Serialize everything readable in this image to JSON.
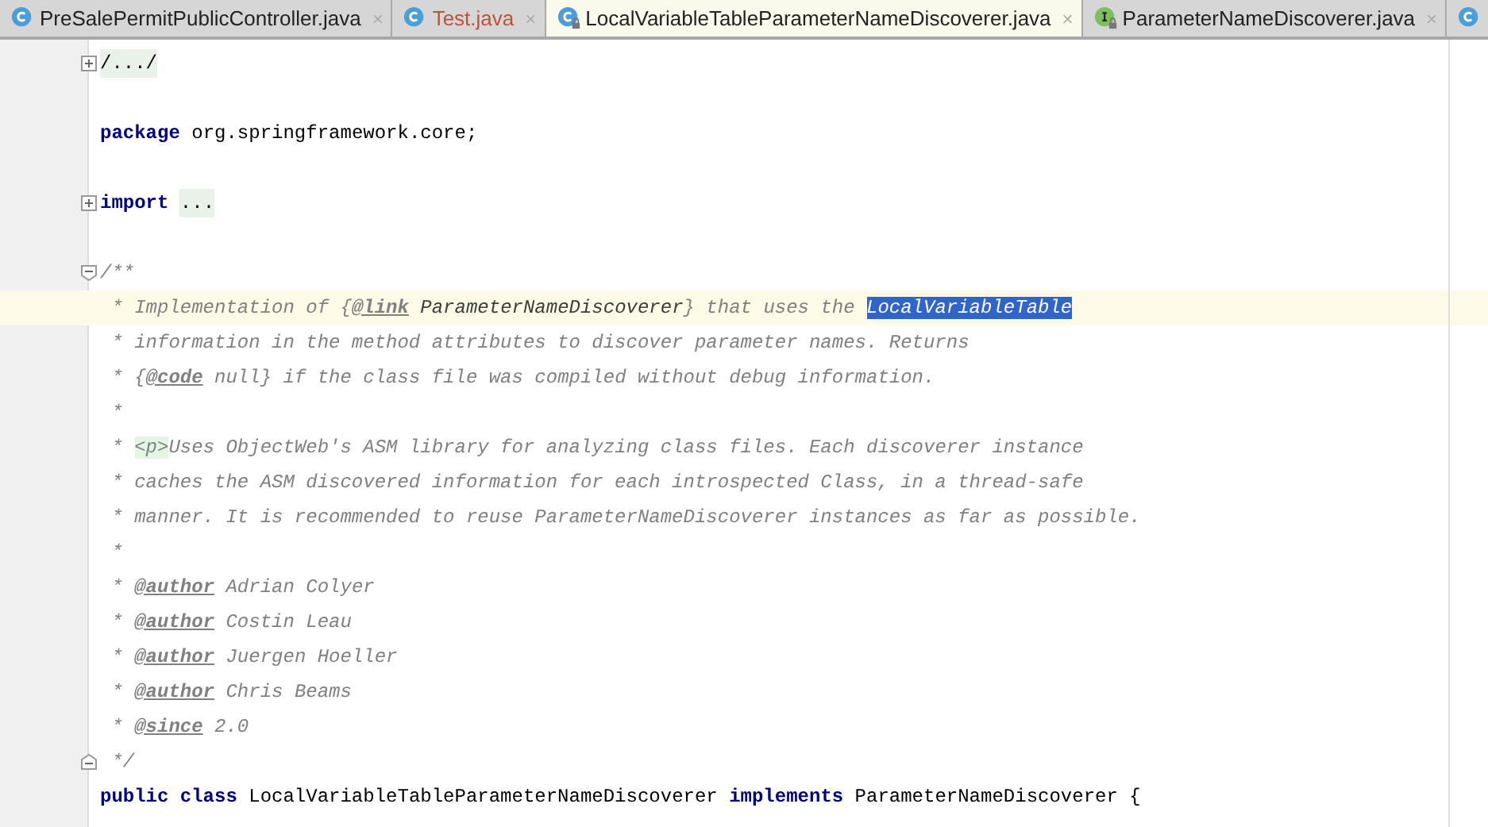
{
  "tabs": [
    {
      "kind": "class",
      "label": "PreSalePermitPublicController.java",
      "selected": false,
      "error": false,
      "close": "×"
    },
    {
      "kind": "class",
      "label": "Test.java",
      "selected": false,
      "error": true,
      "close": "×"
    },
    {
      "kind": "class-locked",
      "label": "LocalVariableTableParameterNameDiscoverer.java",
      "selected": true,
      "error": false,
      "close": "×"
    },
    {
      "kind": "interface-locked",
      "label": "ParameterNameDiscoverer.java",
      "selected": false,
      "error": false,
      "close": "×"
    },
    {
      "kind": "class",
      "selected": false
    }
  ],
  "editor": {
    "lines": [
      {
        "kind": "fold-collapsed",
        "current": false,
        "tokens": [
          {
            "kind": "folded",
            "text": "/.../"
          }
        ]
      },
      {
        "kind": "plain",
        "current": false
      },
      {
        "kind": "plain",
        "current": false,
        "tokens": [
          {
            "kind": "keyword",
            "text": "package"
          },
          {
            "kind": "plain",
            "text": " org.springframework.core;"
          }
        ]
      },
      {
        "kind": "plain",
        "current": false
      },
      {
        "kind": "fold-collapsed",
        "current": false,
        "tokens": [
          {
            "kind": "keyword",
            "text": "import "
          },
          {
            "kind": "folded",
            "text": "..."
          }
        ]
      },
      {
        "kind": "plain",
        "current": false
      },
      {
        "kind": "fold-start",
        "current": false,
        "tokens": [
          {
            "kind": "comment",
            "text": "/**"
          }
        ]
      },
      {
        "kind": "plain",
        "current": true,
        "tokens": [
          {
            "kind": "comment",
            "text": " * Implementation of {"
          },
          {
            "kind": "doctag",
            "text": "@link"
          },
          {
            "kind": "docref",
            "text": " ParameterNameDiscoverer"
          },
          {
            "kind": "comment",
            "text": "} that uses the "
          },
          {
            "kind": "selection",
            "text": "LocalVariableTable"
          }
        ]
      },
      {
        "kind": "plain",
        "current": false,
        "tokens": [
          {
            "kind": "comment",
            "text": " * information in the method attributes to discover parameter names. Returns"
          }
        ]
      },
      {
        "kind": "plain",
        "current": false,
        "tokens": [
          {
            "kind": "comment",
            "text": " * {"
          },
          {
            "kind": "doctag",
            "text": "@code"
          },
          {
            "kind": "comment",
            "text": " null} if the class file was compiled without debug information."
          }
        ]
      },
      {
        "kind": "plain",
        "current": false,
        "tokens": [
          {
            "kind": "comment",
            "text": " *"
          }
        ]
      },
      {
        "kind": "plain",
        "current": false,
        "tokens": [
          {
            "kind": "comment",
            "text": " * "
          },
          {
            "kind": "htmltag",
            "text": "<p>"
          },
          {
            "kind": "comment",
            "text": "Uses ObjectWeb's ASM library for analyzing class files. Each discoverer instance"
          }
        ]
      },
      {
        "kind": "plain",
        "current": false,
        "tokens": [
          {
            "kind": "comment",
            "text": " * caches the ASM discovered information for each introspected Class, in a thread-safe"
          }
        ]
      },
      {
        "kind": "plain",
        "current": false,
        "tokens": [
          {
            "kind": "comment",
            "text": " * manner. It is recommended to reuse ParameterNameDiscoverer instances as far as possible."
          }
        ]
      },
      {
        "kind": "plain",
        "current": false,
        "tokens": [
          {
            "kind": "comment",
            "text": " *"
          }
        ]
      },
      {
        "kind": "plain",
        "current": false,
        "tokens": [
          {
            "kind": "comment",
            "text": " * "
          },
          {
            "kind": "doctag",
            "text": "@author"
          },
          {
            "kind": "comment",
            "text": " Adrian Colyer"
          }
        ]
      },
      {
        "kind": "plain",
        "current": false,
        "tokens": [
          {
            "kind": "comment",
            "text": " * "
          },
          {
            "kind": "doctag",
            "text": "@author"
          },
          {
            "kind": "comment",
            "text": " Costin Leau"
          }
        ]
      },
      {
        "kind": "plain",
        "current": false,
        "tokens": [
          {
            "kind": "comment",
            "text": " * "
          },
          {
            "kind": "doctag",
            "text": "@author"
          },
          {
            "kind": "comment",
            "text": " Juergen Hoeller"
          }
        ]
      },
      {
        "kind": "plain",
        "current": false,
        "tokens": [
          {
            "kind": "comment",
            "text": " * "
          },
          {
            "kind": "doctag",
            "text": "@author"
          },
          {
            "kind": "comment",
            "text": " Chris Beams"
          }
        ]
      },
      {
        "kind": "plain",
        "current": false,
        "tokens": [
          {
            "kind": "comment",
            "text": " * "
          },
          {
            "kind": "doctag",
            "text": "@since"
          },
          {
            "kind": "comment",
            "text": " 2.0"
          }
        ]
      },
      {
        "kind": "fold-end",
        "current": false,
        "tokens": [
          {
            "kind": "comment",
            "text": " */"
          }
        ]
      },
      {
        "kind": "plain",
        "current": false,
        "tokens": [
          {
            "kind": "keyword",
            "text": "public class"
          },
          {
            "kind": "plain",
            "text": " LocalVariableTableParameterNameDiscoverer "
          },
          {
            "kind": "keyword",
            "text": "implements"
          },
          {
            "kind": "plain",
            "text": " ParameterNameDiscoverer {"
          }
        ]
      }
    ]
  }
}
